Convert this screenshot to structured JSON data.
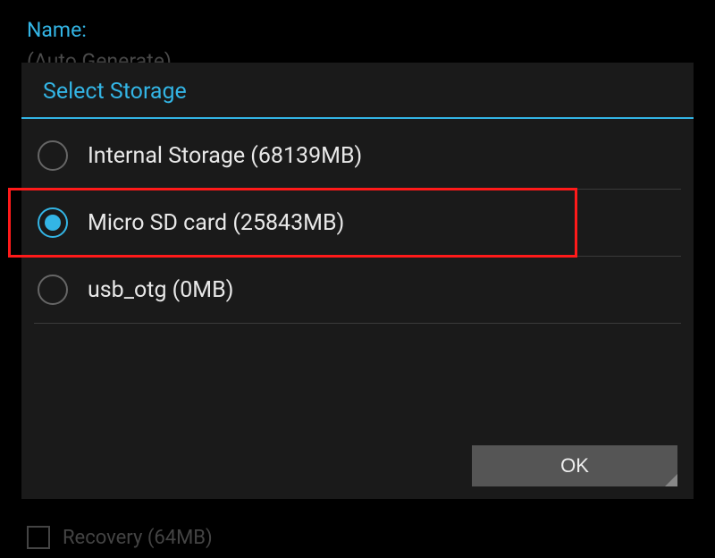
{
  "background": {
    "name_label": "Name:",
    "name_value": "(Auto Generate)",
    "recovery_label": "Recovery (64MB)"
  },
  "dialog": {
    "title": "Select Storage",
    "options": [
      {
        "label": "Internal Storage (68139MB)",
        "selected": false
      },
      {
        "label": "Micro SD card (25843MB)",
        "selected": true,
        "highlighted": true
      },
      {
        "label": "usb_otg (0MB)",
        "selected": false
      }
    ],
    "ok_label": "OK"
  },
  "colors": {
    "accent": "#33b5e5",
    "highlight": "#ff1a1a"
  }
}
